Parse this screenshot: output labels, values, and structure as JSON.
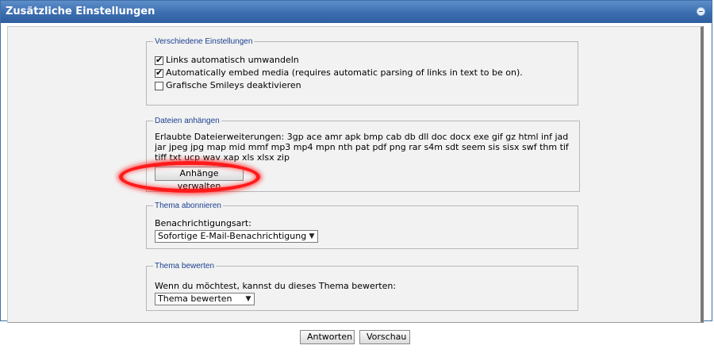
{
  "panel": {
    "title": "Zusätzliche Einstellungen"
  },
  "misc_settings": {
    "legend": "Verschiedene Einstellungen",
    "options": [
      {
        "label": "Links automatisch umwandeln",
        "checked": true
      },
      {
        "label": "Automatically embed media (requires automatic parsing of links in text to be on).",
        "checked": true
      },
      {
        "label": "Grafische Smileys deaktivieren",
        "checked": false
      }
    ]
  },
  "attachments": {
    "legend": "Dateien anhängen",
    "allowed_label": "Erlaubte Dateierweiterungen:",
    "allowed_extensions": "3gp ace amr apk bmp cab db dll doc docx exe gif gz html inf jad jar jpeg jpg map mid mmf mp3 mp4 mpn nth pat pdf png rar s4m sdt seem sis sisx swf thm tif tiff txt ucp wav xap xls xlsx zip",
    "manage_button": "Anhänge verwalten"
  },
  "subscribe": {
    "legend": "Thema abonnieren",
    "label": "Benachrichtigungsart:",
    "selected": "Sofortige E-Mail-Benachrichtigung"
  },
  "rate": {
    "legend": "Thema bewerten",
    "label": "Wenn du möchtest, kannst du dieses Thema bewerten:",
    "selected": "Thema bewerten"
  },
  "actions": {
    "reply": "Antworten",
    "preview": "Vorschau"
  },
  "colors": {
    "header": "#3b6eb0",
    "legend_text": "#1b3f8f",
    "highlight": "#ff1a1a"
  }
}
